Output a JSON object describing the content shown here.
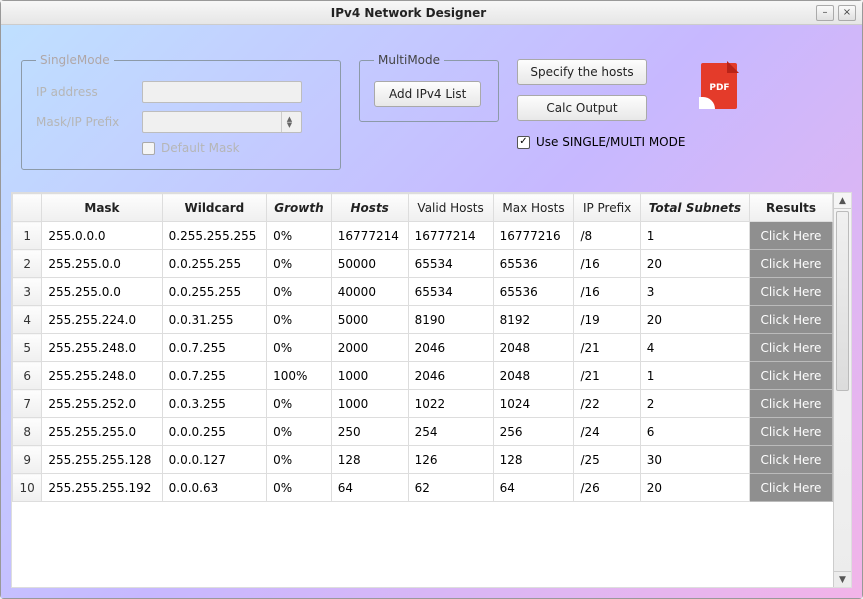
{
  "window": {
    "title": "IPv4 Network Designer"
  },
  "single": {
    "legend": "SingleMode",
    "ip_label": "IP address",
    "mask_label": "Mask/IP Prefix",
    "default_mask_label": "Default Mask"
  },
  "multi": {
    "legend": "MultiMode",
    "add_button": "Add IPv4 List"
  },
  "actions": {
    "specify": "Specify the hosts",
    "calc": "Calc Output",
    "pdf_label": "PDF",
    "mode_label": "Use SINGLE/MULTI  MODE"
  },
  "table": {
    "headers": {
      "mask": "Mask",
      "wildcard": "Wildcard",
      "growth": "Growth",
      "hosts": "Hosts",
      "valid_hosts": "Valid Hosts",
      "max_hosts": "Max Hosts",
      "ip_prefix": "IP Prefix",
      "total_subnets": "Total Subnets",
      "results": "Results"
    },
    "result_label": "Click Here",
    "rows": [
      {
        "n": "1",
        "mask": "255.0.0.0",
        "wildcard": "0.255.255.255",
        "growth": "0%",
        "hosts": "16777214",
        "valid": "16777214",
        "max": "16777216",
        "prefix": "/8",
        "subnets": "1"
      },
      {
        "n": "2",
        "mask": "255.255.0.0",
        "wildcard": "0.0.255.255",
        "growth": "0%",
        "hosts": "50000",
        "valid": "65534",
        "max": "65536",
        "prefix": "/16",
        "subnets": "20"
      },
      {
        "n": "3",
        "mask": "255.255.0.0",
        "wildcard": "0.0.255.255",
        "growth": "0%",
        "hosts": "40000",
        "valid": "65534",
        "max": "65536",
        "prefix": "/16",
        "subnets": "3"
      },
      {
        "n": "4",
        "mask": "255.255.224.0",
        "wildcard": "0.0.31.255",
        "growth": "0%",
        "hosts": "5000",
        "valid": "8190",
        "max": "8192",
        "prefix": "/19",
        "subnets": "20"
      },
      {
        "n": "5",
        "mask": "255.255.248.0",
        "wildcard": "0.0.7.255",
        "growth": "0%",
        "hosts": "2000",
        "valid": "2046",
        "max": "2048",
        "prefix": "/21",
        "subnets": "4"
      },
      {
        "n": "6",
        "mask": "255.255.248.0",
        "wildcard": "0.0.7.255",
        "growth": "100%",
        "hosts": "1000",
        "valid": "2046",
        "max": "2048",
        "prefix": "/21",
        "subnets": "1"
      },
      {
        "n": "7",
        "mask": "255.255.252.0",
        "wildcard": "0.0.3.255",
        "growth": "0%",
        "hosts": "1000",
        "valid": "1022",
        "max": "1024",
        "prefix": "/22",
        "subnets": "2"
      },
      {
        "n": "8",
        "mask": "255.255.255.0",
        "wildcard": "0.0.0.255",
        "growth": "0%",
        "hosts": "250",
        "valid": "254",
        "max": "256",
        "prefix": "/24",
        "subnets": "6"
      },
      {
        "n": "9",
        "mask": "255.255.255.128",
        "wildcard": "0.0.0.127",
        "growth": "0%",
        "hosts": "128",
        "valid": "126",
        "max": "128",
        "prefix": "/25",
        "subnets": "30"
      },
      {
        "n": "10",
        "mask": "255.255.255.192",
        "wildcard": "0.0.0.63",
        "growth": "0%",
        "hosts": "64",
        "valid": "62",
        "max": "64",
        "prefix": "/26",
        "subnets": "20"
      }
    ]
  }
}
